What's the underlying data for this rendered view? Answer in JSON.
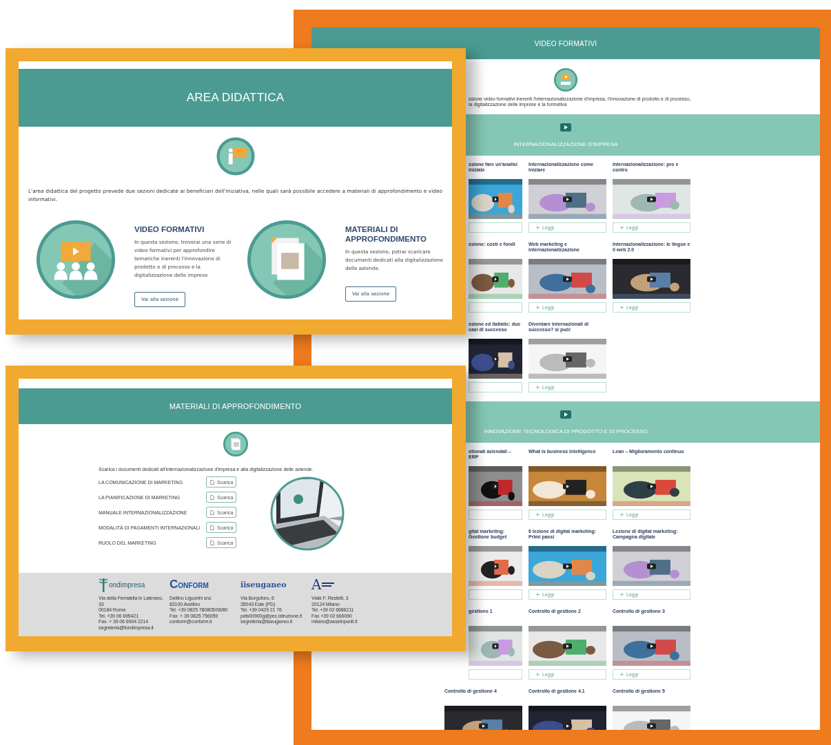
{
  "video_page": {
    "title": "VIDEO FORMATIVI",
    "description": "ssione video formativi inerenti l'internazionalizzazione d'impresa, l'innovazione di prodotto e di processo, la digitalizzazione delle imprese e la formativa",
    "sections": [
      {
        "title": "INTERNAZIONALIZZAZIONE D'IMPRESA",
        "videos": [
          {
            "kind": "cut",
            "title": "ssione fare un'analisi iniziale"
          },
          {
            "kind": "full",
            "title": "Internazionalizzazione come iniziare",
            "button": "Leggi"
          },
          {
            "kind": "full",
            "title": "Internazionalizzazione: pro e contro",
            "button": "Leggi"
          },
          {
            "kind": "cut",
            "title": "ssione: costi e fondi"
          },
          {
            "kind": "full",
            "title": "Web marketing e internazionalizzazione",
            "button": "Leggi"
          },
          {
            "kind": "full",
            "title": "Internazionalizzazione: le lingue e il web 2.0",
            "button": "Leggi"
          },
          {
            "kind": "cut",
            "title": "ssione ed italiatic: due casi di successo"
          },
          {
            "kind": "full",
            "title": "Diventare internazionali di successo? si può!",
            "button": "Leggi"
          }
        ]
      },
      {
        "title": "INNOVAZIONE TECNOLOGICA DI PRODOTTO E DI PROCESSO",
        "videos": [
          {
            "kind": "cut",
            "title": "stionali aziendali – ERP"
          },
          {
            "kind": "full",
            "title": "What is business intelligence",
            "button": "Leggi"
          },
          {
            "kind": "full",
            "title": "Lean – Miglioramento continuo",
            "button": "Leggi"
          },
          {
            "kind": "cut",
            "title": "gital marketing: Gestione budget"
          },
          {
            "kind": "full",
            "title": "6 lezione di digital marketing: Primi passi",
            "button": "Leggi"
          },
          {
            "kind": "full",
            "title": "Lezione di digital marketing: Campagna digitale",
            "button": "Leggi"
          },
          {
            "kind": "cut",
            "title": "gestione 1"
          },
          {
            "kind": "full",
            "title": "Controllo di gestione 2",
            "button": "Leggi"
          },
          {
            "kind": "full",
            "title": "Controllo di gestione 3",
            "button": "Leggi"
          },
          {
            "kind": "full",
            "title": "Controllo di gestione 4"
          },
          {
            "kind": "full",
            "title": "Controllo di gestione 4.1"
          },
          {
            "kind": "full",
            "title": "Controllo di gestione 5"
          }
        ]
      }
    ]
  },
  "area_page": {
    "title": "AREA DIDATTICA",
    "intro": "L'area didattica del progetto prevede due sezioni dedicate ai beneficiari dell'iniziativa, nelle quali sarà possibile accedere a materiali di approfondimento e video informativi.",
    "features": [
      {
        "kind": "video",
        "title": "VIDEO FORMATIVI",
        "description": "In questa sezione, troverai una serie di video formativi per approfondire tematiche inerenti l'innovazione di prodotto e di processo e la digitalizzazione delle imprese",
        "button": "Vai alla sezione"
      },
      {
        "kind": "documents",
        "title": "MATERIALI DI APPROFONDIMENTO",
        "description": "In questa sezione, potrai scaricare documenti dedicati alla digitalizzazione delle aziende.",
        "button": "Vai alla sezione"
      }
    ]
  },
  "materials_page": {
    "title": "MATERIALI DI APPROFONDIMENTO",
    "intro": "Scarica i documenti dedicati all'internazionalizzazione d'impresa e alla digitalizzazione delle aziende.",
    "documents": [
      {
        "label": "LA COMUNICAZIONE DI MARKETING",
        "button": "Scarica"
      },
      {
        "label": "LA PIANIFICAZIONE DI MARKETING",
        "button": "Scarica"
      },
      {
        "label": "MANUALE INTERNAZIONALIZZAZIONE",
        "button": "Scarica"
      },
      {
        "label": "MODALITÀ DI PAGAMENTI INTERNAZIONALI",
        "button": "Scarica"
      },
      {
        "label": "RUOLO DEL MARKETING",
        "button": "Scarica"
      }
    ],
    "footer": [
      {
        "kind": "fondimpresa",
        "logo": "ondimpresa",
        "address": [
          "Via della Ferratella in Laterano, 33",
          "00184 Roma",
          "Tel. +39 06 695421",
          "Fax. + 39 06 6994 2214",
          "segreteria@fondimpresa.it"
        ]
      },
      {
        "kind": "conform",
        "logo": "CONFORM",
        "address": [
          "Dellino Liguorini snc",
          "83100 Avellino",
          "Tel. +39 0825 780805/06/80",
          "Fax. + 39 0825 756059",
          "conform@conform.it"
        ]
      },
      {
        "kind": "school",
        "logo": "iiseuganeo",
        "address": [
          "Via Borgofuro, 6",
          "35043 Este (PD)",
          "Tel. +39 0429 21 76",
          "pdis00900g@pec.istruzione.it",
          "segreteria@iiseuganeo.it"
        ]
      },
      {
        "kind": "mark",
        "logo": "A",
        "address": [
          "Viale F. Restelli, 3",
          "20124 Milano",
          "Tel. +39 02 6686211",
          "Fax +39 02 666090",
          "milano@asseinpunti.it"
        ]
      }
    ]
  }
}
